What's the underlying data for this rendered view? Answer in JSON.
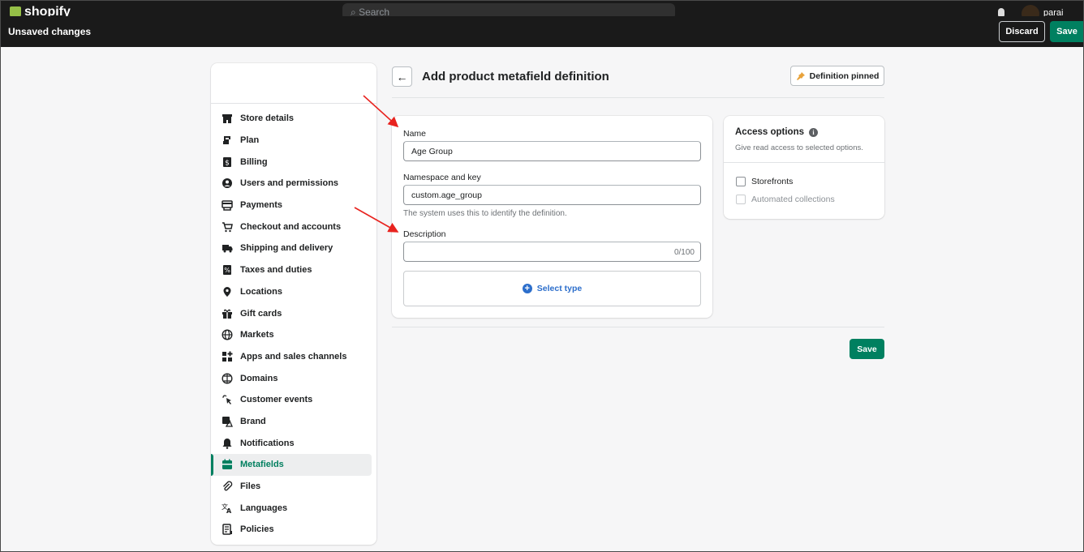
{
  "shopify_bar": {
    "logo_text": "shopify",
    "search_placeholder": "Search",
    "user_text": "parai gurjar"
  },
  "save_bar": {
    "title": "Unsaved changes",
    "discard_label": "Discard",
    "save_label": "Save"
  },
  "sidebar": {
    "items": [
      {
        "label": "Store details",
        "icon": "store-icon"
      },
      {
        "label": "Plan",
        "icon": "plan-icon"
      },
      {
        "label": "Billing",
        "icon": "billing-icon"
      },
      {
        "label": "Users and permissions",
        "icon": "user-icon"
      },
      {
        "label": "Payments",
        "icon": "payments-icon"
      },
      {
        "label": "Checkout and accounts",
        "icon": "cart-icon"
      },
      {
        "label": "Shipping and delivery",
        "icon": "truck-icon"
      },
      {
        "label": "Taxes and duties",
        "icon": "tax-icon"
      },
      {
        "label": "Locations",
        "icon": "location-pin-icon"
      },
      {
        "label": "Gift cards",
        "icon": "gift-icon"
      },
      {
        "label": "Markets",
        "icon": "globe-icon"
      },
      {
        "label": "Apps and sales channels",
        "icon": "apps-icon"
      },
      {
        "label": "Domains",
        "icon": "domains-icon"
      },
      {
        "label": "Customer events",
        "icon": "cursor-click-icon"
      },
      {
        "label": "Brand",
        "icon": "brand-icon"
      },
      {
        "label": "Notifications",
        "icon": "bell-icon"
      },
      {
        "label": "Metafields",
        "icon": "metafields-icon"
      },
      {
        "label": "Files",
        "icon": "paperclip-icon"
      },
      {
        "label": "Languages",
        "icon": "translate-icon"
      },
      {
        "label": "Policies",
        "icon": "policies-icon"
      }
    ],
    "active": "Metafields"
  },
  "header": {
    "title": "Add product metafield definition",
    "pin_label": "Definition pinned"
  },
  "form": {
    "name_label": "Name",
    "name_value": "Age Group",
    "namespace_label": "Namespace and key",
    "namespace_value": "custom.age_group",
    "namespace_help": "The system uses this to identify the definition.",
    "description_label": "Description",
    "description_value": "",
    "description_count": "0/100",
    "select_type_label": "Select type"
  },
  "access": {
    "title": "Access options",
    "subtitle": "Give read access to selected options.",
    "options": [
      {
        "label": "Storefronts",
        "checked": false,
        "disabled": false
      },
      {
        "label": "Automated collections",
        "checked": false,
        "disabled": true
      }
    ]
  },
  "footer": {
    "save_label": "Save"
  },
  "colors": {
    "primary_green": "#008060",
    "link_blue": "#2c6ecb",
    "annotation_red": "#e8231f",
    "pin_orange": "#e8a23a"
  }
}
